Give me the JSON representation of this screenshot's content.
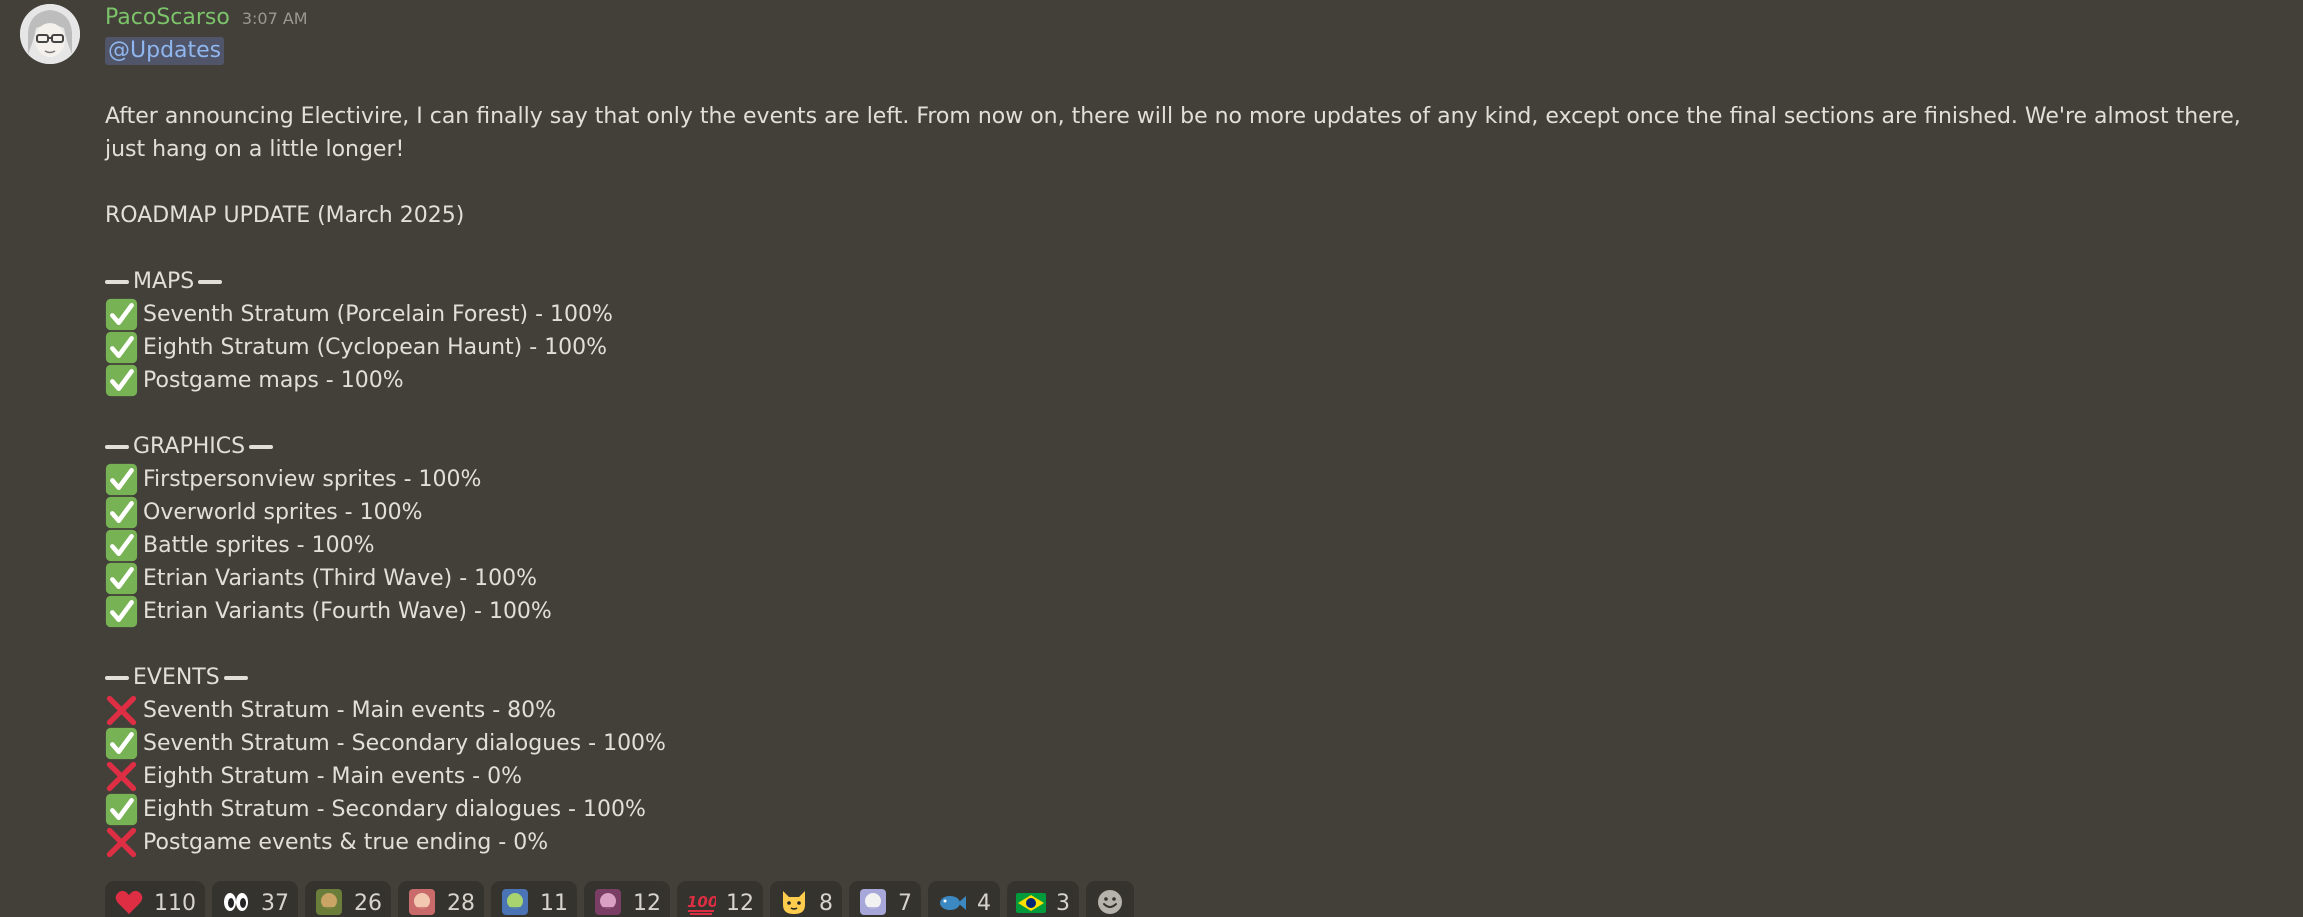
{
  "message": {
    "username": "PacoScarso",
    "timestamp": "3:07 AM",
    "mention": "@Updates",
    "intro": "After announcing Electivire, I can finally say that only the events are left. From now on, there will be no more updates of any kind, except once the final sections are finished. We're almost there, just hang on a little longer!",
    "roadmap_title": "ROADMAP UPDATE (March 2025)",
    "sections": [
      {
        "title": "MAPS",
        "items": [
          {
            "text": "Seventh Stratum (Porcelain Forest) - 100%",
            "done": true
          },
          {
            "text": "Eighth Stratum (Cyclopean Haunt) - 100%",
            "done": true
          },
          {
            "text": "Postgame maps - 100%",
            "done": true
          }
        ]
      },
      {
        "title": "GRAPHICS",
        "items": [
          {
            "text": "Firstpersonview sprites - 100%",
            "done": true
          },
          {
            "text": "Overworld sprites - 100%",
            "done": true
          },
          {
            "text": "Battle sprites - 100%",
            "done": true
          },
          {
            "text": "Etrian Variants (Third Wave) - 100%",
            "done": true
          },
          {
            "text": "Etrian Variants (Fourth Wave) - 100%",
            "done": true
          }
        ]
      },
      {
        "title": "EVENTS",
        "items": [
          {
            "text": "Seventh Stratum - Main events - 80%",
            "done": false
          },
          {
            "text": "Seventh Stratum - Secondary dialogues - 100%",
            "done": true
          },
          {
            "text": "Eighth Stratum - Main events - 0%",
            "done": false
          },
          {
            "text": "Eighth Stratum - Secondary dialogues - 100%",
            "done": true
          },
          {
            "text": "Postgame events & true ending - 0%",
            "done": false
          }
        ]
      }
    ]
  },
  "reactions": [
    {
      "icon": "heart-icon",
      "count": "110"
    },
    {
      "icon": "eyes-icon",
      "count": "37"
    },
    {
      "icon": "custom-emoji-icon",
      "count": "26"
    },
    {
      "icon": "custom-emoji-icon",
      "count": "28"
    },
    {
      "icon": "custom-emoji-icon",
      "count": "11"
    },
    {
      "icon": "custom-emoji-icon",
      "count": "12"
    },
    {
      "icon": "hundred-icon",
      "count": "12"
    },
    {
      "icon": "cat-icon",
      "count": "8"
    },
    {
      "icon": "custom-emoji-icon",
      "count": "7"
    },
    {
      "icon": "fish-icon",
      "count": "4"
    },
    {
      "icon": "brazil-flag-icon",
      "count": "3"
    }
  ],
  "colors": {
    "background": "#43403a",
    "username": "#7cc36a",
    "check": "#77b255",
    "cross": "#dd2e44",
    "mention_bg": "#515569",
    "mention_text": "#8fb6ee"
  }
}
